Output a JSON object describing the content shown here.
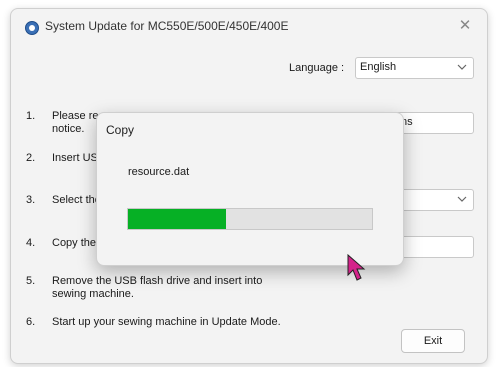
{
  "window": {
    "title": "System Update for MC550E/500E/450E/400E",
    "close_icon": "close-icon",
    "language_label": "Language :",
    "language_value": "English",
    "steps": [
      {
        "num": "1.",
        "text": "Please re"
      },
      {
        "num": "",
        "text": "notice."
      },
      {
        "num": "2.",
        "text": "Insert US"
      },
      {
        "num": "3.",
        "text": "Select the"
      },
      {
        "num": "4.",
        "text": "Copy the"
      },
      {
        "num": "5.",
        "text": "Remove the USB flash drive and insert into"
      },
      {
        "num": "",
        "text": "sewing machine."
      },
      {
        "num": "6.",
        "text": "Start up your sewing machine in Update Mode."
      }
    ],
    "step1_field_text": "ns",
    "exit_label": "Exit"
  },
  "dialog": {
    "title": "Copy",
    "file_name": "resource.dat",
    "progress_fraction": 0.4
  },
  "colors": {
    "progress_fill": "#06b025",
    "cursor": "#d4238a"
  }
}
